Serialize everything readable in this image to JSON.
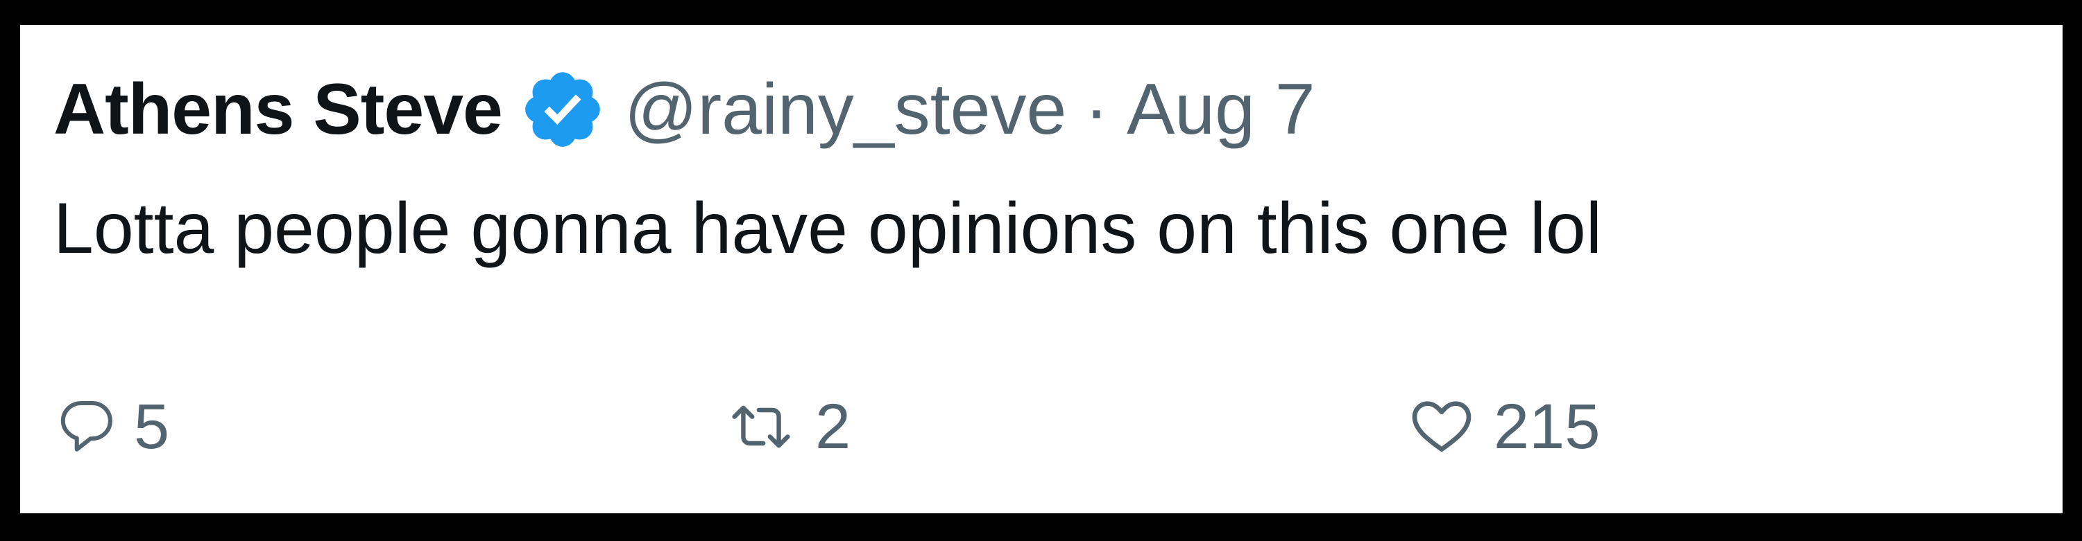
{
  "tweet": {
    "author": {
      "display_name": "Athens Steve",
      "verified_icon": "verified-badge-icon",
      "handle": "@rainy_steve"
    },
    "separator": "·",
    "date": "Aug 7",
    "text": "Lotta people gonna have opinions on this one lol",
    "actions": {
      "reply": {
        "icon": "reply-icon",
        "count": "5"
      },
      "retweet": {
        "icon": "retweet-icon",
        "count": "2"
      },
      "like": {
        "icon": "heart-icon",
        "count": "215"
      }
    }
  },
  "colors": {
    "frame": "#000000",
    "card": "#ffffff",
    "primary_text": "#0f1419",
    "secondary_text": "#536471",
    "verified_blue": "#1d9bf0"
  }
}
